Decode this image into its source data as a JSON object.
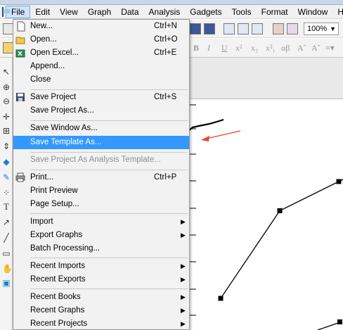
{
  "menubar": {
    "items": [
      "File",
      "Edit",
      "View",
      "Graph",
      "Data",
      "Analysis",
      "Gadgets",
      "Tools",
      "Format",
      "Window",
      "Help"
    ]
  },
  "toolbar": {
    "zoom": "100%",
    "format_labels": [
      "B",
      "I",
      "U",
      "x²",
      "x₂",
      "x²₁",
      "αβ",
      "Aˆ",
      "Aˇ"
    ]
  },
  "file_menu": {
    "new": {
      "label": "New...",
      "shortcut": "Ctrl+N"
    },
    "open": {
      "label": "Open...",
      "shortcut": "Ctrl+O"
    },
    "open_excel": {
      "label": "Open Excel...",
      "shortcut": "Ctrl+E"
    },
    "append": {
      "label": "Append..."
    },
    "close": {
      "label": "Close"
    },
    "save_project": {
      "label": "Save Project",
      "shortcut": "Ctrl+S"
    },
    "save_project_as": {
      "label": "Save Project As..."
    },
    "save_window_as": {
      "label": "Save Window As..."
    },
    "save_template_as": {
      "label": "Save Template As..."
    },
    "save_analysis_template": {
      "label": "Save Project As Analysis Template..."
    },
    "print": {
      "label": "Print...",
      "shortcut": "Ctrl+P"
    },
    "print_preview": {
      "label": "Print Preview"
    },
    "page_setup": {
      "label": "Page Setup..."
    },
    "import": {
      "label": "Import"
    },
    "export_graphs": {
      "label": "Export Graphs"
    },
    "batch_processing": {
      "label": "Batch Processing..."
    },
    "recent_imports": {
      "label": "Recent Imports"
    },
    "recent_exports": {
      "label": "Recent Exports"
    },
    "recent_books": {
      "label": "Recent Books"
    },
    "recent_graphs": {
      "label": "Recent Graphs"
    },
    "recent_projects": {
      "label": "Recent Projects"
    }
  },
  "graph": {
    "points": [
      [
        1,
        1
      ],
      [
        2,
        4
      ],
      [
        3,
        5
      ],
      [
        4,
        6
      ]
    ]
  },
  "annotation": {
    "arrow_color": "#e8423a",
    "scribble_color": "#000000"
  },
  "colors": {
    "highlight": "#3399ff",
    "menu_bg": "#f2f2f2",
    "disabled_text": "#8e8e8e"
  }
}
